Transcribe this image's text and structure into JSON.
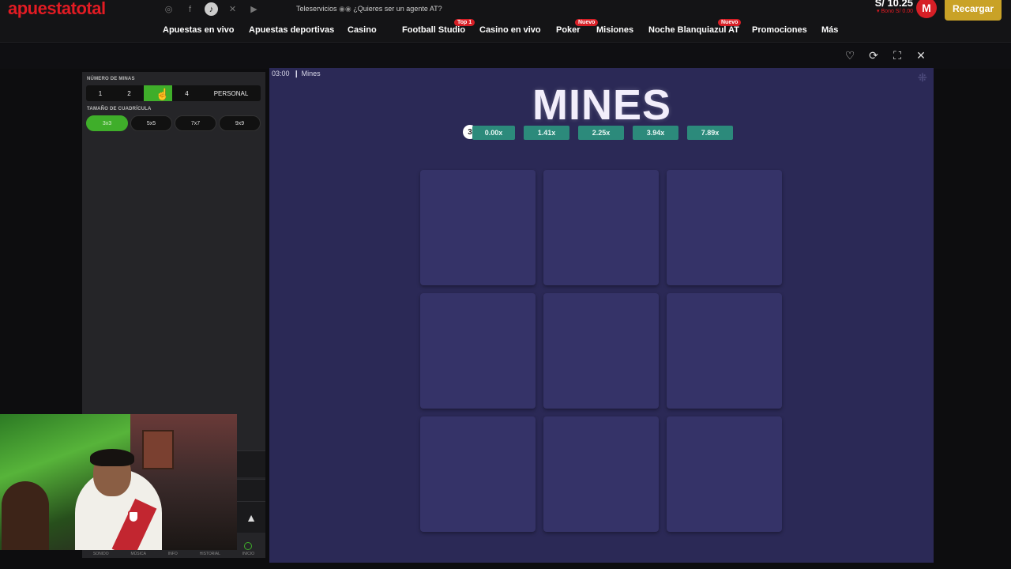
{
  "header": {
    "logo": "apuestatotal",
    "socials": [
      "instagram-icon",
      "facebook-icon",
      "tiktok-icon",
      "x-icon",
      "youtube-icon"
    ],
    "teleservicios": "Teleservicios",
    "agent_text": "¿Quieres ser un agente AT?",
    "balance": "S/ 10.25",
    "bono": "Bono S/ 0.00",
    "avatar_initial": "M",
    "recargar": "Recargar"
  },
  "nav": {
    "items": [
      {
        "label": "Apuestas en vivo"
      },
      {
        "label": "Apuestas deportivas"
      },
      {
        "label": "Casino"
      },
      {
        "label": "Football Studio",
        "badge": "Top 1"
      },
      {
        "label": "Casino en vivo"
      },
      {
        "label": "Poker",
        "badge": "Nuevo"
      },
      {
        "label": "Misiones"
      },
      {
        "label": "Noche Blanquiazul AT",
        "badge": "Nuevo"
      },
      {
        "label": "Promociones"
      },
      {
        "label": "Más"
      }
    ]
  },
  "game_controls": {
    "icons": [
      "heart-icon",
      "refresh-icon",
      "fullscreen-icon",
      "close-icon"
    ]
  },
  "left_panel": {
    "mines_label": "NÚMERO DE MINAS",
    "mines_options": [
      "1",
      "2",
      "3",
      "4",
      "PERSONAL"
    ],
    "mines_selected": "3",
    "grid_label": "TAMAÑO DE CUADRÍCULA",
    "grid_options": [
      "3x3",
      "5x5",
      "7x7",
      "9x9"
    ],
    "grid_selected": "3x3",
    "bottom_menu": [
      "SONIDO",
      "MÚSICA",
      "INFO",
      "HISTORIAL",
      "INICIO"
    ]
  },
  "game": {
    "timer": "03:00",
    "game_name": "Mines",
    "title": "MINES",
    "bomb_count": "3",
    "multipliers": [
      "0.00x",
      "1.41x",
      "2.25x",
      "3.94x",
      "7.89x"
    ],
    "tiles": 9
  },
  "colors": {
    "brand_red": "#e21b23",
    "accent_green": "#3fae2a",
    "multiplier_teal": "#2c8a7b",
    "game_bg": "#2b2956",
    "tile": "#353368",
    "recargar_gold": "#c9a227"
  }
}
